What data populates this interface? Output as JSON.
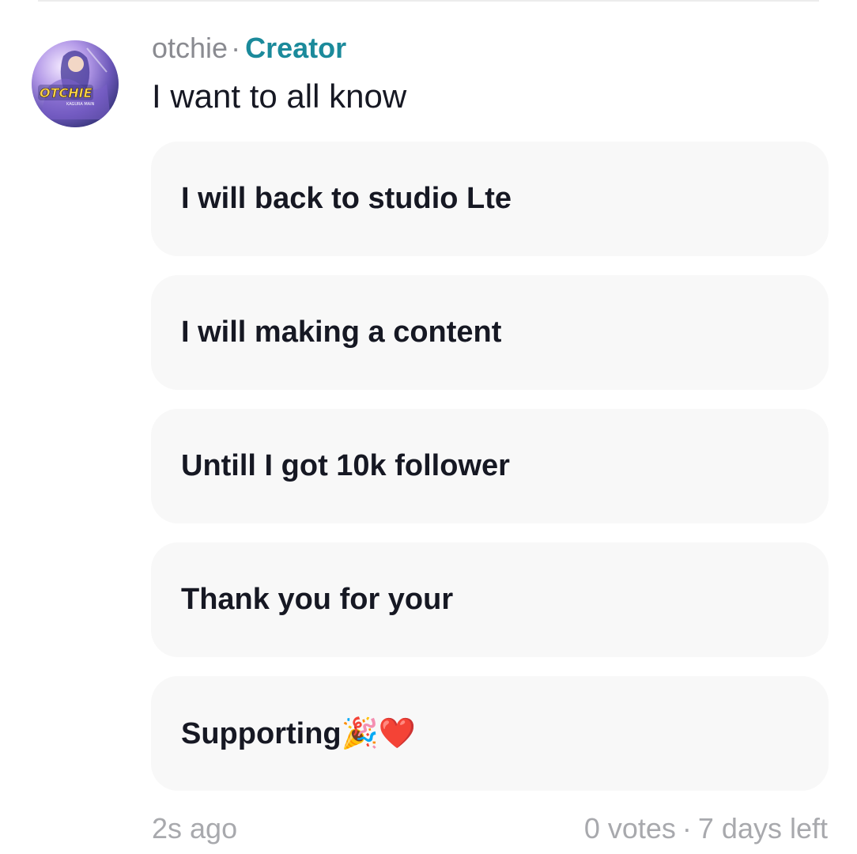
{
  "post": {
    "username": "otchie",
    "separator": "·",
    "badge": "Creator",
    "question": "I want to all know",
    "avatar_text": "OTCHIE",
    "avatar_subtext": "KAGURA MAIN"
  },
  "poll": {
    "options": [
      {
        "label": "I will back to studio Lte"
      },
      {
        "label": "I will making a content"
      },
      {
        "label": "Untill I got 10k follower"
      },
      {
        "label": "Thank you for your"
      },
      {
        "label": "Supporting🎉❤️"
      }
    ],
    "posted_time": "2s ago",
    "votes": "0 votes",
    "separator": "·",
    "time_left": "7 days left"
  },
  "colors": {
    "badge": "#1b8a9b",
    "option_bg": "#f8f8f8",
    "muted_text": "#a8a9ad"
  },
  "icons": {
    "avatar": "profile-avatar-image"
  }
}
